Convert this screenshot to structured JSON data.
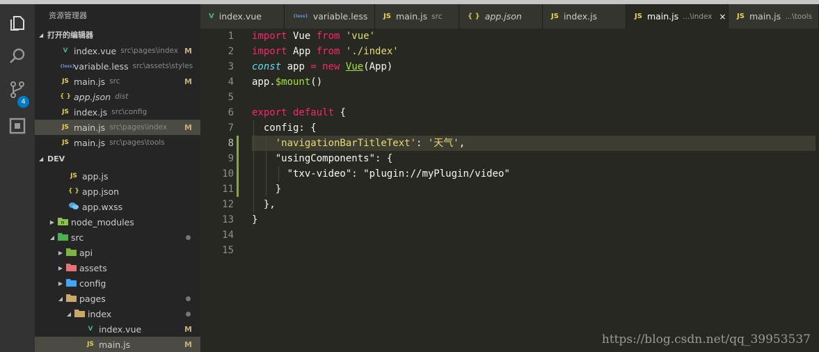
{
  "sidebar": {
    "title": "资源管理器",
    "open_editors_header": "打开的编辑器",
    "open_editors": [
      {
        "icon": "V",
        "name": "index.vue",
        "path": "src\\pages\\index",
        "status": "M"
      },
      {
        "icon": "{less}",
        "name": "variable.less",
        "path": "src\\assets\\styles",
        "status": ""
      },
      {
        "icon": "JS",
        "name": "main.js",
        "path": "src",
        "status": "M"
      },
      {
        "icon": "{ }",
        "name": "app.json",
        "path": "dist",
        "status": ""
      },
      {
        "icon": "JS",
        "name": "index.js",
        "path": "src\\config",
        "status": ""
      },
      {
        "icon": "JS",
        "name": "main.js",
        "path": "src\\pages\\index",
        "status": "M"
      },
      {
        "icon": "JS",
        "name": "main.js",
        "path": "src\\pages\\tools",
        "status": ""
      }
    ],
    "project_header": "DEV",
    "tree": [
      {
        "icon": "JS",
        "name": "app.js",
        "status": ""
      },
      {
        "icon": "{ }",
        "name": "app.json",
        "status": ""
      },
      {
        "icon": "wx",
        "name": "app.wxss",
        "status": ""
      },
      {
        "icon": "folder",
        "name": "node_modules",
        "status": ""
      },
      {
        "icon": "folder",
        "name": "src",
        "status": "dot"
      },
      {
        "icon": "folder",
        "name": "api",
        "status": ""
      },
      {
        "icon": "folder",
        "name": "assets",
        "status": ""
      },
      {
        "icon": "folder",
        "name": "config",
        "status": ""
      },
      {
        "icon": "folder",
        "name": "pages",
        "status": "dot"
      },
      {
        "icon": "folder",
        "name": "index",
        "status": "dot"
      },
      {
        "icon": "V",
        "name": "index.vue",
        "status": "M"
      },
      {
        "icon": "JS",
        "name": "main.js",
        "status": "M"
      }
    ]
  },
  "activity": {
    "scm_badge": "4",
    "icons": [
      "files-icon",
      "search-icon",
      "source-control-icon",
      "extensions-icon"
    ]
  },
  "tabs": [
    {
      "icon": "V",
      "label": "index.vue",
      "desc": ""
    },
    {
      "icon": "{less}",
      "label": "variable.less",
      "desc": ""
    },
    {
      "icon": "JS",
      "label": "main.js",
      "desc": "src"
    },
    {
      "icon": "{ }",
      "label": "app.json",
      "desc": ""
    },
    {
      "icon": "JS",
      "label": "index.js",
      "desc": ""
    },
    {
      "icon": "JS",
      "label": "main.js",
      "desc": "...\\index",
      "close": "×"
    },
    {
      "icon": "JS",
      "label": "main.js",
      "desc": "...\\tools"
    }
  ],
  "editor": {
    "line_numbers": [
      "1",
      "2",
      "3",
      "4",
      "5",
      "6",
      "7",
      "8",
      "9",
      "10",
      "11",
      "12",
      "13",
      "14",
      "15"
    ],
    "current_line": "8",
    "lines": {
      "l1": {
        "a": "import",
        "b": " Vue ",
        "c": "from",
        "d": " 'vue'"
      },
      "l2": {
        "a": "import",
        "b": " App ",
        "c": "from",
        "d": " './index'"
      },
      "l3": {
        "a": "const",
        "b": " app ",
        "c": "=",
        "d": " new",
        "e": "Vue",
        "f": "(App)"
      },
      "l4": {
        "a": "app.",
        "b": "$mount",
        "c": "()"
      },
      "l6": {
        "a": "export default",
        "b": " {"
      },
      "l7": {
        "a": "  config: ",
        "b": "{"
      },
      "l8": {
        "a": "    'navigationBarTitleText'",
        "b": ": ",
        "c": "'天气'",
        "d": ","
      },
      "l9": {
        "a": "    \"usingComponents\"",
        "b": ": ",
        "c": "{"
      },
      "l10": {
        "a": "      \"txv-video\"",
        "b": ": ",
        "c": "\"plugin://myPlugin/video\""
      },
      "l11": {
        "a": "    }"
      },
      "l12": {
        "a": "  },"
      },
      "l13": {
        "a": "}"
      }
    }
  },
  "watermark": "https://blog.csdn.net/qq_39953537"
}
